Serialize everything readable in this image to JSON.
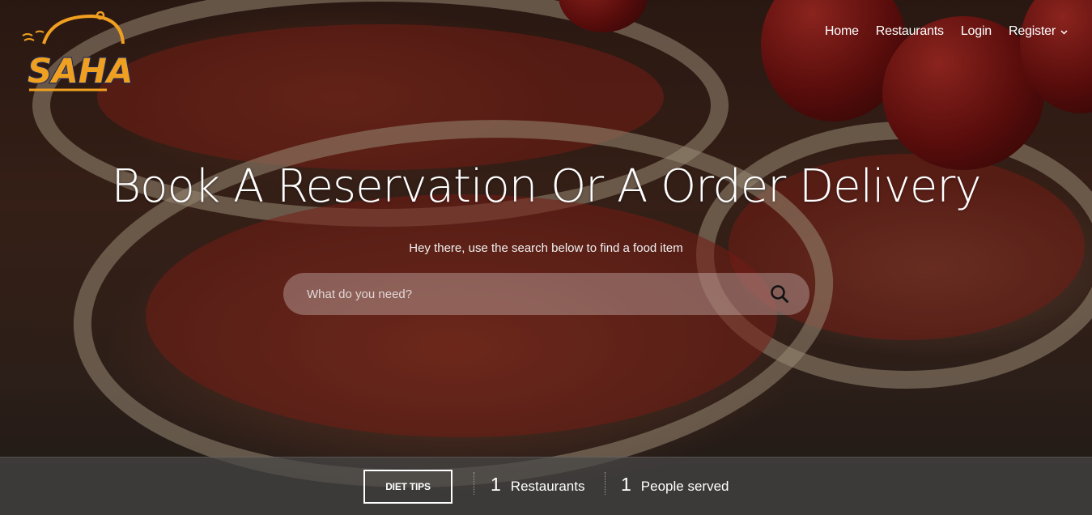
{
  "brand": {
    "logo_text": "SAHANI"
  },
  "nav": {
    "items": [
      {
        "label": "Home"
      },
      {
        "label": "Restaurants"
      },
      {
        "label": "Login"
      },
      {
        "label": "Register"
      }
    ]
  },
  "hero": {
    "headline": "Book A Reservation Or A Order Delivery",
    "subtitle": "Hey there, use the search below to find a food item"
  },
  "search": {
    "placeholder": "What do you need?",
    "value": ""
  },
  "footer_bar": {
    "diet_button": "DIET TIPS",
    "stats": [
      {
        "value": "1",
        "label": "Restaurants"
      },
      {
        "value": "1",
        "label": "People served"
      }
    ]
  },
  "colors": {
    "logo_orange": "#f0a020",
    "logo_navy": "#1c2a5a"
  },
  "icons": {
    "search": "search-icon",
    "dropdown": "chevron-down-icon"
  }
}
